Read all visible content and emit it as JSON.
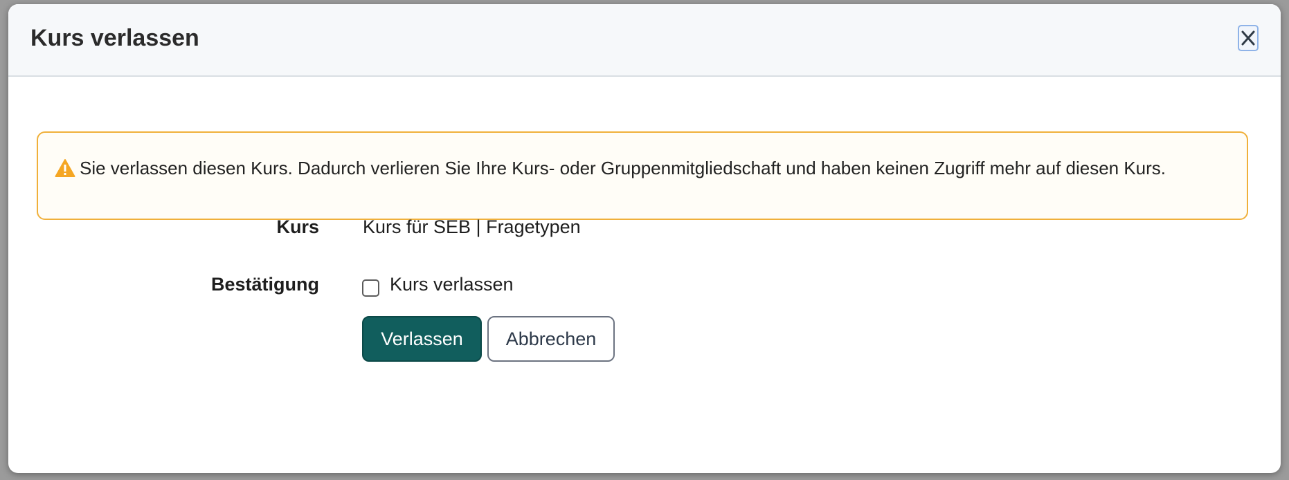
{
  "dialog": {
    "title": "Kurs verlassen",
    "close_icon": "close-icon"
  },
  "alert": {
    "icon": "warning-icon",
    "text": "Sie verlassen diesen Kurs. Dadurch verlieren Sie Ihre Kurs- oder Gruppenmitgliedschaft und haben keinen Zugriff mehr auf diesen Kurs."
  },
  "form": {
    "course_label": "Kurs",
    "course_value": "Kurs für SEB | Fragetypen",
    "confirm_label": "Bestätigung",
    "confirm_checkbox_label": "Kurs verlassen",
    "confirm_checked": false
  },
  "buttons": {
    "primary": "Verlassen",
    "secondary": "Abbrechen"
  },
  "colors": {
    "primary": "#115e5d",
    "warning_border": "#f0b03a",
    "warning_icon": "#f5a623"
  }
}
